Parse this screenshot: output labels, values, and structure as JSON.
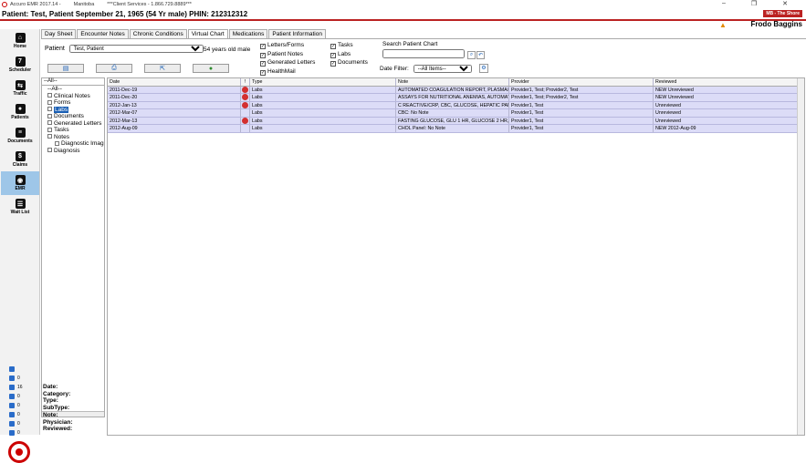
{
  "app": {
    "title": "Accuro EMR 2017.14 -",
    "province": "Manitoba",
    "client_services": "***Client Services - 1.866.729.8889***",
    "window_controls": [
      "–",
      "❐",
      "✕"
    ]
  },
  "patient_bar": {
    "text": "Patient: Test, Patient   September 21, 1965 (54 Yr  male)  PHIN:  212312312",
    "site": "MB - The Shore"
  },
  "user": {
    "name": "Frodo Baggins",
    "warning_icon": "warning-icon"
  },
  "nav": [
    {
      "label": "Home",
      "icon": "home-icon"
    },
    {
      "label": "Scheduler",
      "icon": "calendar-icon"
    },
    {
      "label": "Traffic",
      "icon": "traffic-icon"
    },
    {
      "label": "Patients",
      "icon": "patient-icon"
    },
    {
      "label": "Documents",
      "icon": "documents-icon"
    },
    {
      "label": "Claims",
      "icon": "claims-icon"
    },
    {
      "label": "EMR",
      "icon": "emr-icon",
      "active": true
    },
    {
      "label": "Wait List",
      "icon": "waitlist-icon"
    }
  ],
  "counts": [
    "0",
    "16",
    "0",
    "0",
    "0",
    "0",
    "0"
  ],
  "tabs": [
    "Day Sheet",
    "Encounter Notes",
    "Chronic Conditions",
    "Virtual Chart",
    "Medications",
    "Patient Information"
  ],
  "active_tab": "Virtual Chart",
  "patient_select": {
    "label": "Patient",
    "value": "Test, Patient",
    "age": "54 years old male"
  },
  "filters_col1": [
    "Letters/Forms",
    "Patient Notes",
    "Generated Letters",
    "HealthMail"
  ],
  "filters_col2": [
    "Tasks",
    "Labs",
    "Documents"
  ],
  "search": {
    "label": "Search Patient Chart",
    "value": ""
  },
  "date_filter": {
    "label": "Date Filter:",
    "value": "--All Items--"
  },
  "tree": {
    "selector": "--All--",
    "items": [
      "--All--",
      "Clinical Notes",
      "Forms",
      "Labs",
      "Documents",
      "Generated Letters",
      "Tasks",
      "Notes",
      "Diagnostic Imag",
      "Diagnosis"
    ],
    "selected": "Labs"
  },
  "details_labels": [
    "Date:",
    "Category:",
    "Type:",
    "SubType:",
    "Note:",
    "Physician:",
    "Reviewed:"
  ],
  "grid": {
    "columns": [
      "Date",
      "!",
      "Type",
      "Note",
      "Provider",
      "Reviewed"
    ],
    "rows": [
      {
        "date": "2011-Dec-19",
        "flag": true,
        "type": "Labs",
        "note": "AUTOMATED COAGULATION REPORT, PLASMA/SER...",
        "provider": "Provider1, Test; Provider2, Test",
        "reviewed": "NEW Unreviewed"
      },
      {
        "date": "2011-Dec-20",
        "flag": true,
        "type": "Labs",
        "note": "ASSAYS FOR NUTRITIONAL ANEMIAS, AUTOMATED...",
        "provider": "Provider1, Test; Provider2, Test",
        "reviewed": "NEW Unreviewed"
      },
      {
        "date": "2012-Jan-13",
        "flag": true,
        "type": "Labs",
        "note": "C REACTIVE/CRP, CBC, GLUCOSE, HEPATIC PANEL, I...",
        "provider": "Provider1, Test",
        "reviewed": "Unreviewed"
      },
      {
        "date": "2012-Mar-07",
        "flag": false,
        "type": "Labs",
        "note": "CBC: No Note",
        "provider": "Provider1, Test",
        "reviewed": "Unreviewed"
      },
      {
        "date": "2012-Mar-13",
        "flag": true,
        "type": "Labs",
        "note": "FASTING GLUCOSE, GLU 1 HR, GLUCOSE 2 HR, TSH...",
        "provider": "Provider1, Test",
        "reviewed": "Unreviewed"
      },
      {
        "date": "2012-Aug-09",
        "flag": false,
        "type": "Labs",
        "note": "CHOL Panel: No Note",
        "provider": "Provider1, Test",
        "reviewed": "NEW 2012-Aug-09"
      }
    ]
  }
}
